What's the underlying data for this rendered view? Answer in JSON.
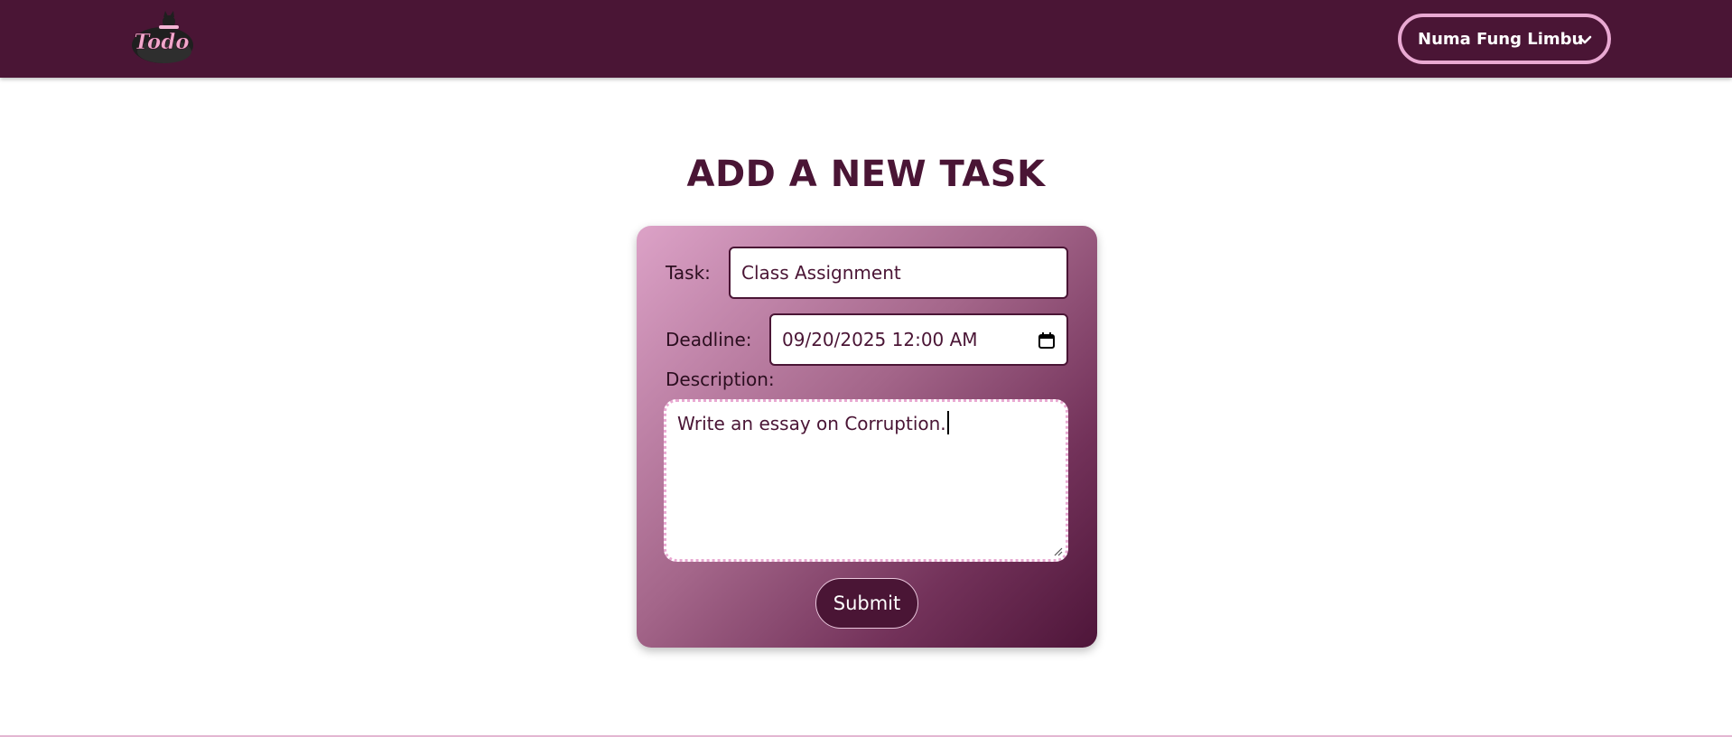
{
  "header": {
    "logo_text": "Todo",
    "user_name": "Numa Fung Limbu",
    "user_menu_icon": "chevron-down-icon"
  },
  "main": {
    "title": "ADD A NEW TASK"
  },
  "form": {
    "task_label": "Task:",
    "task_value": "Class Assignment",
    "deadline_label": "Deadline:",
    "deadline_value": "09/20/2025 12:00 AM",
    "deadline_icon": "calendar-icon",
    "description_label": "Description:",
    "description_value": "Write an essay on Corruption.",
    "submit_label": "Submit"
  },
  "colors": {
    "brand": "#4a1535",
    "accent_pink": "#e9a9d2",
    "card_gradient_start": "#dca2c7",
    "card_gradient_end": "#4e1539"
  }
}
